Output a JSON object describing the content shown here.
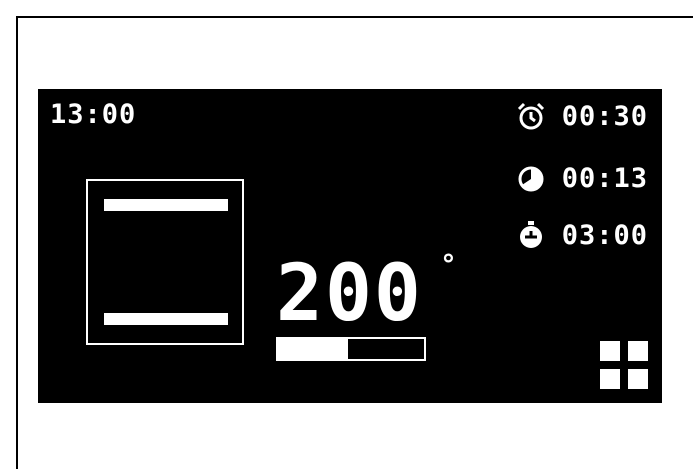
{
  "display": {
    "clock": "13:00",
    "timers": [
      {
        "icon": "alarm-clock-icon",
        "value": "00:30"
      },
      {
        "icon": "pie-progress-icon",
        "value": "00:13"
      },
      {
        "icon": "stopwatch-icon",
        "value": "03:00"
      }
    ],
    "temperature": "200",
    "degree_symbol": "°",
    "progress": 0.48,
    "menu_icon": "grid-menu-icon",
    "oven_icon": "oven-top-bottom-heat-icon"
  },
  "colors": {
    "screen_bg": "#000000",
    "foreground": "#ffffff",
    "page_bg": "#ffffff"
  }
}
